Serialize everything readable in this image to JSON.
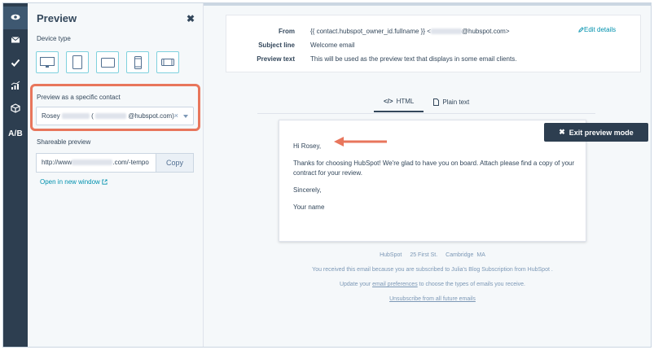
{
  "rail": {
    "items": [
      {
        "icon": "eye-icon"
      },
      {
        "icon": "envelope-icon"
      },
      {
        "icon": "checkmark-icon"
      },
      {
        "icon": "analytics-icon"
      },
      {
        "icon": "cube-icon"
      },
      {
        "label": "A/B"
      }
    ]
  },
  "panel": {
    "title": "Preview",
    "close": "✖",
    "device_type_label": "Device type",
    "devices": [
      "desktop-icon",
      "tablet-portrait-icon",
      "tablet-landscape-icon",
      "phone-portrait-icon",
      "phone-landscape-icon"
    ],
    "contact_label": "Preview as a specific contact",
    "contact_first": "Rosey",
    "contact_open": "(",
    "contact_domain": "@hubspot.com)",
    "contact_clear": "×",
    "share_label": "Shareable preview",
    "share_prefix": "http://www",
    "share_suffix": ".com/-tempo",
    "copy_label": "Copy",
    "open_link": "Open in new window"
  },
  "header": {
    "from_label": "From",
    "from_value_prefix": "{{ contact.hubspot_owner_id.fullname }} <",
    "from_value_suffix": "@hubspot.com>",
    "subject_label": "Subject line",
    "subject_value": "Welcome email",
    "preview_label": "Preview text",
    "preview_value": "This will be used as the preview text that displays in some email clients.",
    "edit_label": "Edit details"
  },
  "tabs": {
    "html": "HTML",
    "plain": "Plain text"
  },
  "email": {
    "greeting": "Hi Rosey,",
    "body": "Thanks for choosing HubSpot! We're glad to have you on board. Attach please find a copy of your contract for your review.",
    "signoff": "Sincerely,",
    "name": "Your name"
  },
  "exit_button": "Exit preview mode",
  "footer": {
    "company": "HubSpot",
    "street": "25 First St.",
    "city": "Cambridge",
    "state": "MA",
    "reason": "You received this email because you are subscribed to Julia's Blog Subscription from HubSpot .",
    "update_prefix": "Update your",
    "update_link": "email preferences",
    "update_suffix": "to choose the types of emails you receive.",
    "unsubscribe": "Unsubscribe from all future emails"
  },
  "colors": {
    "rail": "#2d3e50",
    "highlight": "#e8765c",
    "link": "#0091ae",
    "device_border": "#7fd1de"
  }
}
